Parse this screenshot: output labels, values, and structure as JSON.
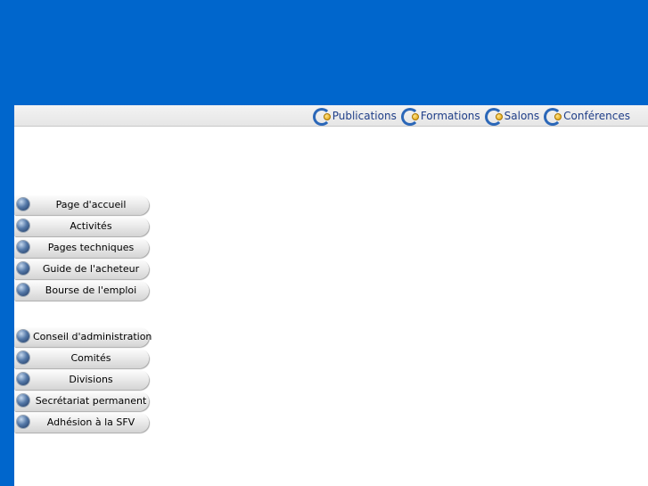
{
  "top_nav": {
    "items": [
      {
        "label": "Publications",
        "icon": "c-logo-icon"
      },
      {
        "label": "Formations",
        "icon": "c-logo-icon"
      },
      {
        "label": "Salons",
        "icon": "c-logo-icon"
      },
      {
        "label": "Conférences",
        "icon": "c-logo-icon"
      }
    ]
  },
  "side_menu": {
    "group1": [
      {
        "label": "Page d'accueil"
      },
      {
        "label": "Activités"
      },
      {
        "label": "Pages techniques"
      },
      {
        "label": "Guide de l'acheteur"
      },
      {
        "label": "Bourse de l'emploi"
      }
    ],
    "group2": [
      {
        "label": "Conseil d'administration"
      },
      {
        "label": "Comités"
      },
      {
        "label": "Divisions"
      },
      {
        "label": "Secrétariat permanent"
      },
      {
        "label": "Adhésion à la SFV"
      }
    ]
  },
  "colors": {
    "brand_blue": "#0066cc",
    "nav_text": "#1f3e88",
    "logo_dot": "#e0a000"
  }
}
